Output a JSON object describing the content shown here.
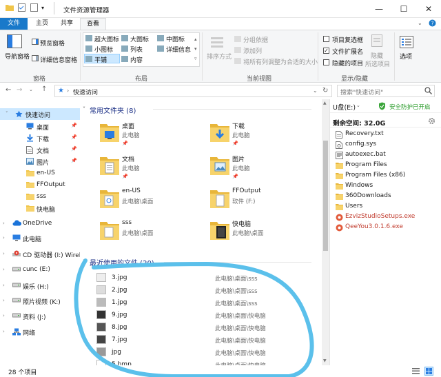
{
  "window": {
    "title": "文件资源管理器",
    "controls": {
      "minimize": "—",
      "maximize": "☐",
      "close": "✕"
    }
  },
  "tabs": [
    {
      "label": "文件"
    },
    {
      "label": "主页"
    },
    {
      "label": "共享"
    },
    {
      "label": "查看"
    }
  ],
  "ribbon": {
    "pane_group": {
      "nav_pane": "导航窗格",
      "preview_pane": "预览窗格",
      "details_pane": "详细信息窗格",
      "label": "窗格"
    },
    "layout_group": {
      "items": [
        "超大图标",
        "大图标",
        "中图标",
        "小图标",
        "列表",
        "详细信息",
        "平铺",
        "内容"
      ],
      "label": "布局"
    },
    "view_group": {
      "sort": "排序方式",
      "group_by": "分组依据",
      "add_column": "添加列",
      "fit_columns": "将所有列调整为合适的大小",
      "label": "当前视图"
    },
    "show_group": {
      "item_checkboxes": "项目复选框",
      "extensions": "文件扩展名",
      "hidden_items": "隐藏的项目",
      "hide": "隐藏",
      "selected_items": "所选项目",
      "options": "选项",
      "label": "显示/隐藏",
      "extensions_checked": true
    }
  },
  "address": {
    "path": "快速访问",
    "search_placeholder": "搜索\"快速访问\""
  },
  "nav": [
    {
      "label": "快速访问",
      "icon": "star-icon",
      "selected": true,
      "chevron": "˅"
    },
    {
      "label": "桌面",
      "icon": "desktop-icon",
      "pinned": true
    },
    {
      "label": "下载",
      "icon": "download-icon",
      "pinned": true
    },
    {
      "label": "文档",
      "icon": "document-icon",
      "pinned": true
    },
    {
      "label": "图片",
      "icon": "picture-icon",
      "pinned": true
    },
    {
      "label": "en-US",
      "icon": "folder-icon"
    },
    {
      "label": "FFOutput",
      "icon": "folder-icon"
    },
    {
      "label": "sss",
      "icon": "folder-icon"
    },
    {
      "label": "快电脑",
      "icon": "folder-icon"
    },
    {
      "label": "OneDrive",
      "icon": "cloud-icon",
      "chevron": "›"
    },
    {
      "label": "此电脑",
      "icon": "computer-icon",
      "chevron": "›"
    },
    {
      "label": "CD 驱动器 (I:) Wirel",
      "icon": "cd-icon",
      "chevron": "›"
    },
    {
      "label": "cunc (E:)",
      "icon": "drive-icon",
      "chevron": "›"
    },
    {
      "label": "娱乐 (H:)",
      "icon": "drive-icon",
      "chevron": "›"
    },
    {
      "label": "照片视频 (K:)",
      "icon": "drive-icon",
      "chevron": "›"
    },
    {
      "label": "资料 (J:)",
      "icon": "drive-icon",
      "chevron": "›"
    },
    {
      "label": "网络",
      "icon": "network-icon",
      "chevron": "›"
    }
  ],
  "frequent": {
    "title": "常用文件夹 (8)",
    "items": [
      {
        "name": "桌面",
        "path": "此电脑",
        "pinned": true
      },
      {
        "name": "下载",
        "path": "此电脑",
        "pinned": true
      },
      {
        "name": "文档",
        "path": "此电脑",
        "pinned": true
      },
      {
        "name": "图片",
        "path": "此电脑",
        "pinned": true
      },
      {
        "name": "en-US",
        "path": "此电脑\\桌面"
      },
      {
        "name": "FFOutput",
        "path": "软件 (F:)"
      },
      {
        "name": "sss",
        "path": "此电脑\\桌面"
      },
      {
        "name": "快电脑",
        "path": "此电脑\\桌面"
      }
    ]
  },
  "recent": {
    "title": "最近使用的文件 (20)",
    "items": [
      {
        "name": "3.jpg",
        "path": "此电脑\\桌面\\sss"
      },
      {
        "name": "2.jpg",
        "path": "此电脑\\桌面\\sss"
      },
      {
        "name": "1.jpg",
        "path": "此电脑\\桌面\\sss"
      },
      {
        "name": "9.jpg",
        "path": "此电脑\\桌面\\快电脑"
      },
      {
        "name": "8.jpg",
        "path": "此电脑\\桌面\\快电脑"
      },
      {
        "name": "7.jpg",
        "path": "此电脑\\桌面\\快电脑"
      },
      {
        "name": "jpg",
        "path": "此电脑\\桌面\\快电脑"
      },
      {
        "name": "5.bmp",
        "path": "此电脑\\桌面\\快电脑"
      }
    ]
  },
  "preview": {
    "drive": "U盘(E:)",
    "security": "安全防护已开启",
    "free_space": "剩余空间: 32.0G",
    "items": [
      {
        "name": "Recovery.txt",
        "icon": "text-file-icon"
      },
      {
        "name": "config.sys",
        "icon": "system-file-icon"
      },
      {
        "name": "autoexec.bat",
        "icon": "batch-file-icon"
      },
      {
        "name": "Program Files",
        "icon": "folder-icon"
      },
      {
        "name": "Program Files (x86)",
        "icon": "folder-icon"
      },
      {
        "name": "Windows",
        "icon": "folder-icon"
      },
      {
        "name": "360Downloads",
        "icon": "folder-icon"
      },
      {
        "name": "Users",
        "icon": "folder-icon"
      },
      {
        "name": "EzvizStudioSetups.exe",
        "icon": "exe-icon",
        "color": "#c0392b"
      },
      {
        "name": "QeeYou3.0.1.6.exe",
        "icon": "exe-icon",
        "color": "#c0392b"
      }
    ]
  },
  "status": {
    "count": "28 个项目"
  },
  "colors": {
    "accent": "#1979ca",
    "folder": "#f0c54a",
    "selection": "#cce8ff",
    "scribble": "#5bc0eb",
    "security_green": "#2f9e2f"
  }
}
